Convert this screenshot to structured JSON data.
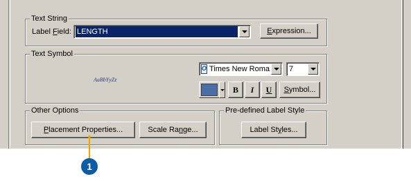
{
  "text_string": {
    "legend": "Text String",
    "label_field_label": "Label Field:",
    "label_field_value": "LENGTH",
    "expression_button": "Expression..."
  },
  "text_symbol": {
    "legend": "Text Symbol",
    "preview_text": "AaBbYyZz",
    "font_name": "Times New Roma",
    "font_size": "7",
    "bold_label": "B",
    "italic_label": "I",
    "underline_label": "U",
    "symbol_button": "Symbol...",
    "color_value": "#4a6ea8"
  },
  "other_options": {
    "legend": "Other Options",
    "placement_button": "Placement Properties...",
    "scale_range_button": "Scale Range..."
  },
  "predefined_style": {
    "legend": "Pre-defined Label Style",
    "label_styles_button": "Label Styles..."
  },
  "callout": {
    "number": "1"
  }
}
